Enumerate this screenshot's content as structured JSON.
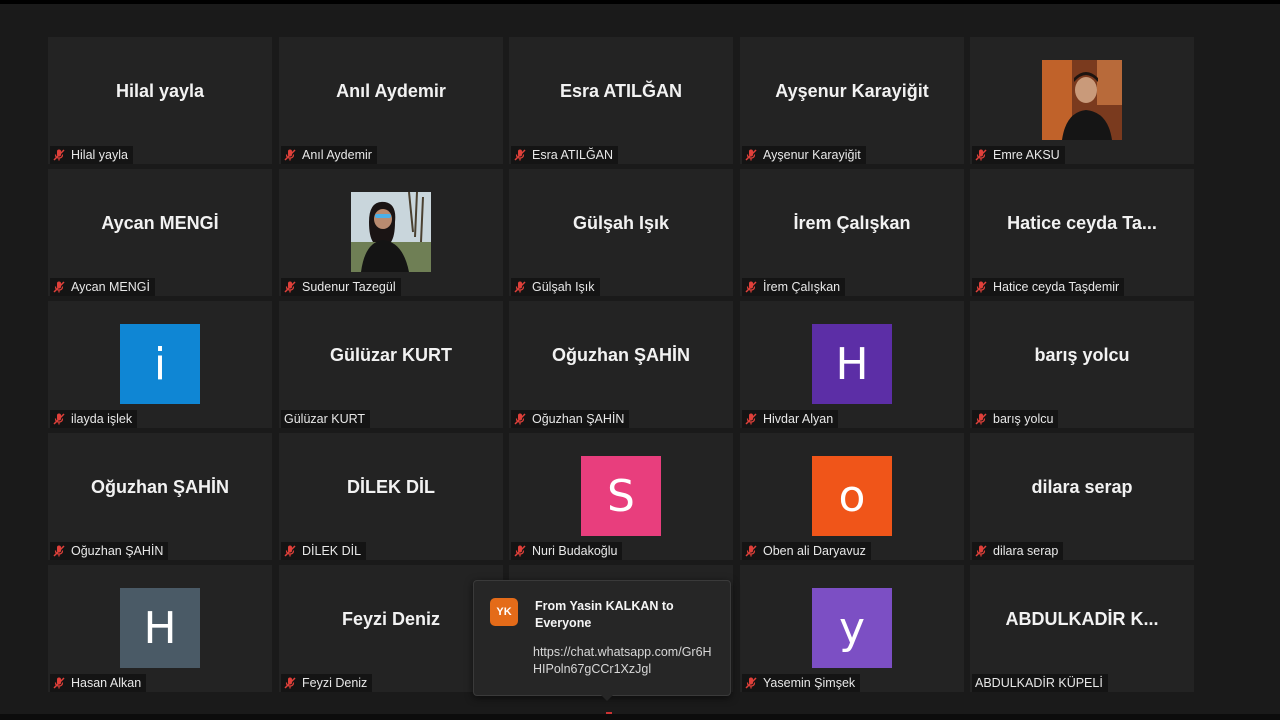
{
  "meeting": {
    "tiles": [
      {
        "name": "Hilal yayla",
        "label": "Hilal yayla",
        "type": "text",
        "muted": true
      },
      {
        "name": "Anıl Aydemir",
        "label": "Anıl Aydemir",
        "type": "text",
        "muted": true
      },
      {
        "name": "Esra ATILĞAN",
        "label": "Esra ATILĞAN",
        "type": "text",
        "muted": true
      },
      {
        "name": "Ayşenur Karayiğit",
        "label": "Ayşenur Karayiğit",
        "type": "text",
        "muted": true
      },
      {
        "name": "",
        "label": "Emre AKSU",
        "type": "photo",
        "photo": "man-portrait",
        "muted": true
      },
      {
        "name": "Aycan MENGİ",
        "label": "Aycan MENGİ",
        "type": "text",
        "muted": true
      },
      {
        "name": "",
        "label": "Sudenur Tazegül",
        "type": "photo",
        "photo": "woman-portrait",
        "muted": true
      },
      {
        "name": "Gülşah Işık",
        "label": "Gülşah Işık",
        "type": "text",
        "muted": true
      },
      {
        "name": "İrem Çalışkan",
        "label": "İrem Çalışkan",
        "type": "text",
        "muted": true
      },
      {
        "name": "Hatice  ceyda  Ta...",
        "label": "Hatice ceyda Taşdemir",
        "type": "text",
        "muted": true
      },
      {
        "name": "",
        "label": "ilayda işlek",
        "type": "initial",
        "initial": "i",
        "color": "#0f86d4",
        "muted": true
      },
      {
        "name": "Gülüzar KURT",
        "label": "Gülüzar KURT",
        "type": "text",
        "muted": false
      },
      {
        "name": "Oğuzhan ŞAHİN",
        "label": "Oğuzhan ŞAHİN",
        "type": "text",
        "muted": true
      },
      {
        "name": "",
        "label": "Hivdar Alyan",
        "type": "initial",
        "initial": "H",
        "color": "#5c2ea6",
        "muted": true
      },
      {
        "name": "barış yolcu",
        "label": "barış yolcu",
        "type": "text",
        "muted": true
      },
      {
        "name": "Oğuzhan ŞAHİN",
        "label": "Oğuzhan ŞAHİN",
        "type": "text",
        "muted": true
      },
      {
        "name": "DİLEK DİL",
        "label": "DİLEK DİL",
        "type": "text",
        "muted": true
      },
      {
        "name": "",
        "label": "Nuri Budakoğlu",
        "type": "initial",
        "initial": "S",
        "color": "#e83e7d",
        "muted": true
      },
      {
        "name": "",
        "label": "Oben ali Daryavuz",
        "type": "initial",
        "initial": "o",
        "color": "#f05519",
        "muted": true
      },
      {
        "name": "dilara serap",
        "label": "dilara serap",
        "type": "text",
        "muted": true
      },
      {
        "name": "",
        "label": "Hasan Alkan",
        "type": "initial",
        "initial": "H",
        "color": "#4a5a66",
        "muted": true
      },
      {
        "name": "Feyzi Deniz",
        "label": "Feyzi Deniz",
        "type": "text",
        "muted": true
      },
      {
        "name": "",
        "label": "",
        "type": "hidden",
        "muted": false
      },
      {
        "name": "",
        "label": "Yasemin Şimşek",
        "type": "initial",
        "initial": "y",
        "color": "#7c4fc4",
        "muted": true
      },
      {
        "name": "ABDULKADİR  K...",
        "label": "ABDULKADİR KÜPELİ",
        "type": "text",
        "muted": false
      }
    ],
    "icons": {
      "muted": "mic-muted-icon"
    },
    "colors": {
      "background": "#1a1a1a",
      "tile": "#232323",
      "muted_icon": "#e0403a"
    }
  },
  "chat_notification": {
    "avatar_initials": "YK",
    "avatar_color": "#e46b19",
    "from_text": "From Yasin KALKAN to Everyone",
    "message": "https://chat.whatsapp.com/Gr6HHIPoln67gCCr1XzJgl"
  }
}
